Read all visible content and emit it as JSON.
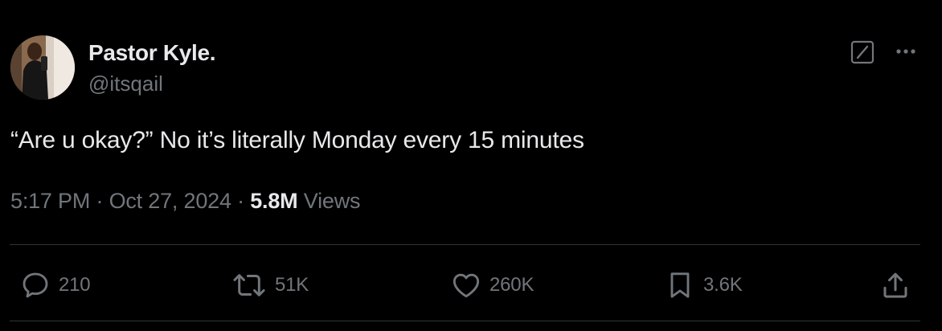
{
  "author": {
    "display_name": "Pastor Kyle.",
    "handle": "@itsqail"
  },
  "tweet": {
    "text": "“Are u okay?” No it’s literally Monday every 15 minutes",
    "time": "5:17 PM",
    "separator": "·",
    "date": "Oct 27, 2024",
    "views_count": "5.8M",
    "views_label": "Views"
  },
  "actions": {
    "replies": "210",
    "reposts": "51K",
    "likes": "260K",
    "bookmarks": "3.6K"
  },
  "icons": {
    "grok": "grok-icon",
    "more": "more-icon",
    "reply": "reply-icon",
    "repost": "repost-icon",
    "like": "like-icon",
    "bookmark": "bookmark-icon",
    "share": "share-icon"
  },
  "colors": {
    "background": "#000000",
    "primary_text": "#e7e9ea",
    "secondary_text": "#71767b",
    "divider": "#2f3336"
  }
}
